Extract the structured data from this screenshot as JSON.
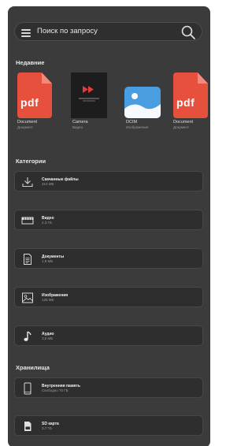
{
  "search": {
    "placeholder": "Поиск по запросу"
  },
  "recent": {
    "title": "Недавние",
    "items": [
      {
        "name": "Document",
        "sub": "Документ",
        "type": "pdf",
        "badge": "pdf"
      },
      {
        "name": "Camera",
        "sub": "Видео",
        "type": "video"
      },
      {
        "name": "DCIM",
        "sub": "Изображение",
        "type": "image"
      },
      {
        "name": "Document",
        "sub": "Документ",
        "type": "pdf",
        "badge": "pdf"
      }
    ]
  },
  "categories": {
    "title": "Категории",
    "items": [
      {
        "title": "Скачанные файлы",
        "size": "310 МБ",
        "icon": "download-icon"
      },
      {
        "title": "Видео",
        "size": "2,3 ГБ",
        "icon": "video-icon"
      },
      {
        "title": "Документы",
        "size": "1,8 МБ",
        "icon": "document-icon"
      },
      {
        "title": "Изображения",
        "size": "125 МБ",
        "icon": "image-icon"
      },
      {
        "title": "Аудио",
        "size": "3,5 МБ",
        "icon": "music-icon"
      }
    ]
  },
  "storage": {
    "title": "Хранилища",
    "items": [
      {
        "title": "Внутренняя память",
        "size": "Свободно 70 ГБ",
        "icon": "phone-icon"
      },
      {
        "title": "SD карта",
        "size": "3,7 ГБ",
        "icon": "sd-card-icon"
      }
    ]
  },
  "colors": {
    "background": "#3b3b3b",
    "card": "#2e2e2e",
    "pdf_red": "#e8503e",
    "image_blue": "#4a9ee0"
  }
}
